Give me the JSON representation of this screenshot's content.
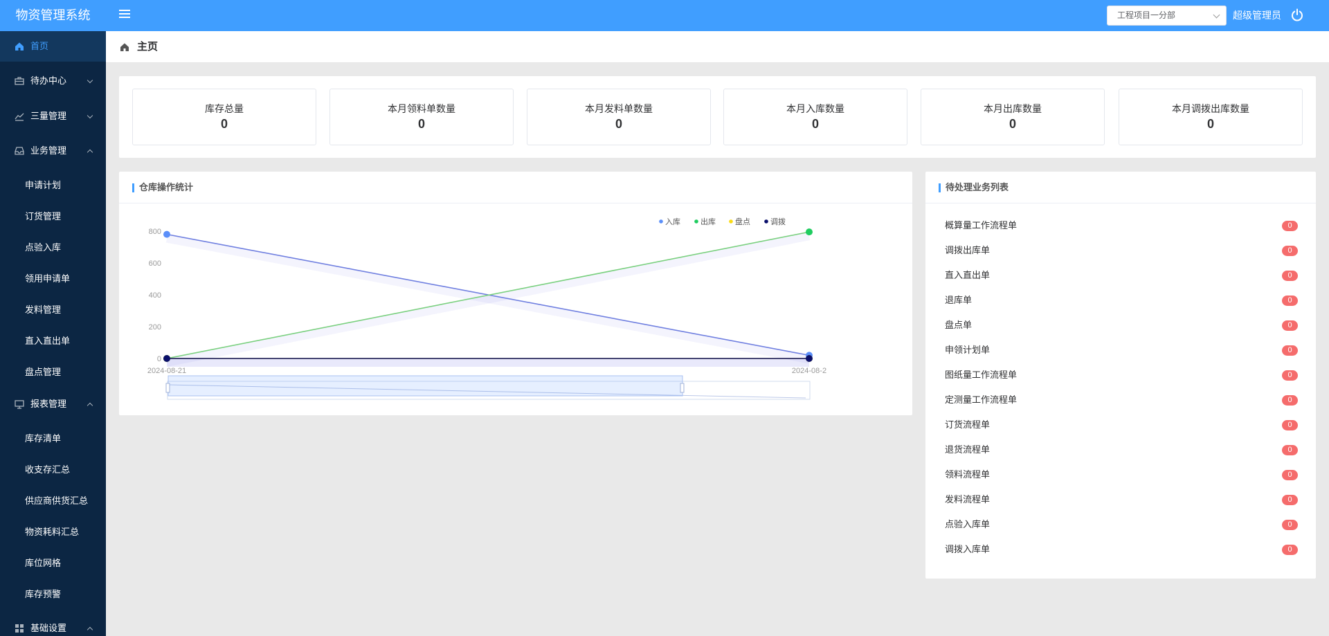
{
  "header": {
    "app_title": "物资管理系统",
    "project_select_value": "工程项目一分部",
    "user_name": "超级管理员"
  },
  "sidebar": {
    "items": [
      {
        "label": "首页",
        "icon": "home-icon",
        "active": true
      },
      {
        "label": "待办中心",
        "icon": "briefcase-icon",
        "expanded": false
      },
      {
        "label": "三量管理",
        "icon": "chart-icon",
        "expanded": false
      },
      {
        "label": "业务管理",
        "icon": "inbox-icon",
        "expanded": true,
        "children": [
          "申请计划",
          "订货管理",
          "点验入库",
          "领用申请单",
          "发料管理",
          "直入直出单",
          "盘点管理"
        ]
      },
      {
        "label": "报表管理",
        "icon": "monitor-icon",
        "expanded": true,
        "children": [
          "库存清单",
          "收支存汇总",
          "供应商供货汇总",
          "物资耗料汇总",
          "库位网格",
          "库存预警"
        ]
      },
      {
        "label": "基础设置",
        "icon": "grid-icon",
        "expanded": true
      }
    ]
  },
  "breadcrumb": {
    "label": "主页"
  },
  "stats": [
    {
      "label": "库存总量",
      "value": "0"
    },
    {
      "label": "本月领料单数量",
      "value": "0"
    },
    {
      "label": "本月发料单数量",
      "value": "0"
    },
    {
      "label": "本月入库数量",
      "value": "0"
    },
    {
      "label": "本月出库数量",
      "value": "0"
    },
    {
      "label": "本月调拨出库数量",
      "value": "0"
    }
  ],
  "chart_panel": {
    "title": "仓库操作统计"
  },
  "todo_panel": {
    "title": "待处理业务列表",
    "items": [
      {
        "label": "概算量工作流程单",
        "count": "0"
      },
      {
        "label": "调拨出库单",
        "count": "0"
      },
      {
        "label": "直入直出单",
        "count": "0"
      },
      {
        "label": "退库单",
        "count": "0"
      },
      {
        "label": "盘点单",
        "count": "0"
      },
      {
        "label": "申领计划单",
        "count": "0"
      },
      {
        "label": "图纸量工作流程单",
        "count": "0"
      },
      {
        "label": "定测量工作流程单",
        "count": "0"
      },
      {
        "label": "订货流程单",
        "count": "0"
      },
      {
        "label": "退货流程单",
        "count": "0"
      },
      {
        "label": "领料流程单",
        "count": "0"
      },
      {
        "label": "发料流程单",
        "count": "0"
      },
      {
        "label": "点验入库单",
        "count": "0"
      },
      {
        "label": "调拨入库单",
        "count": "0"
      }
    ]
  },
  "colors": {
    "primary": "#409eff",
    "sidebar_bg": "#0c2643",
    "badge": "#f56c6c"
  },
  "chart_data": {
    "type": "line",
    "x": [
      "2024-08-21",
      "2024-08-2"
    ],
    "ylim": [
      0,
      800
    ],
    "yticks": [
      "0",
      "200",
      "400",
      "600",
      "800"
    ],
    "legend_position": "top-right",
    "series": [
      {
        "name": "入库",
        "color": "#5b8ff9",
        "values": [
          780,
          20
        ]
      },
      {
        "name": "出库",
        "color": "#1fcc5f",
        "values": [
          0,
          795
        ]
      },
      {
        "name": "盘点",
        "color": "#fadb14",
        "values": [
          0,
          0
        ]
      },
      {
        "name": "调拨",
        "color": "#0a0f6b",
        "values": [
          0,
          0
        ]
      }
    ],
    "datazoom": true
  }
}
